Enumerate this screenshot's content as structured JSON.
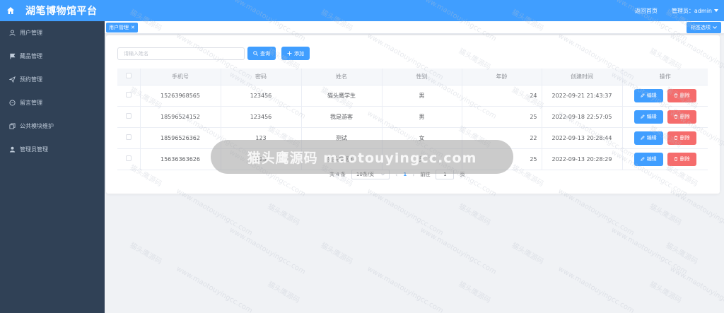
{
  "app": {
    "title": "湖笔博物馆平台"
  },
  "header": {
    "back_home": "返回首页",
    "admin": "管理员：admin"
  },
  "sidebar": {
    "items": [
      {
        "label": "用户管理",
        "icon": "user-icon"
      },
      {
        "label": "藏品管理",
        "icon": "flag-icon"
      },
      {
        "label": "预约管理",
        "icon": "send-icon"
      },
      {
        "label": "留言管理",
        "icon": "chat-icon"
      },
      {
        "label": "公共模块维护",
        "icon": "copy-icon"
      },
      {
        "label": "管理员管理",
        "icon": "person-icon"
      }
    ]
  },
  "tabs": {
    "active": "用户管理",
    "options": "标签选项"
  },
  "toolbar": {
    "search_placeholder": "请输入姓名",
    "search_label": "查询",
    "add_label": "添加"
  },
  "table": {
    "headers": [
      "手机号",
      "密码",
      "姓名",
      "性别",
      "年龄",
      "创建时间",
      "操作"
    ],
    "rows": [
      {
        "phone": "15263968565",
        "password": "123456",
        "name": "猫头鹰学生",
        "gender": "男",
        "age": "24",
        "created": "2022-09-21 21:43:37"
      },
      {
        "phone": "18596524152",
        "password": "123456",
        "name": "我是游客",
        "gender": "男",
        "age": "25",
        "created": "2022-09-18 22:57:05"
      },
      {
        "phone": "18596526362",
        "password": "123",
        "name": "测试",
        "gender": "女",
        "age": "22",
        "created": "2022-09-13 20:28:44"
      },
      {
        "phone": "15636363626",
        "password": "123",
        "name": "猫头鹰源码",
        "gender": "男",
        "age": "25",
        "created": "2022-09-13 20:28:29"
      }
    ],
    "edit_label": "编辑",
    "delete_label": "删除"
  },
  "pagination": {
    "total": "共 4 条",
    "page_size": "10条/页",
    "current_page": "1",
    "goto": "前往",
    "goto_value": "1",
    "page_unit": "页"
  },
  "overlay": {
    "text": "猫头鹰源码 maotouyingcc.com"
  },
  "watermark": {
    "line1": "猫头鹰源码",
    "line2": "www.maotouyingcc.com"
  },
  "colors": {
    "primary": "#409eff",
    "danger": "#f56c6c",
    "sidebar": "#304156"
  }
}
